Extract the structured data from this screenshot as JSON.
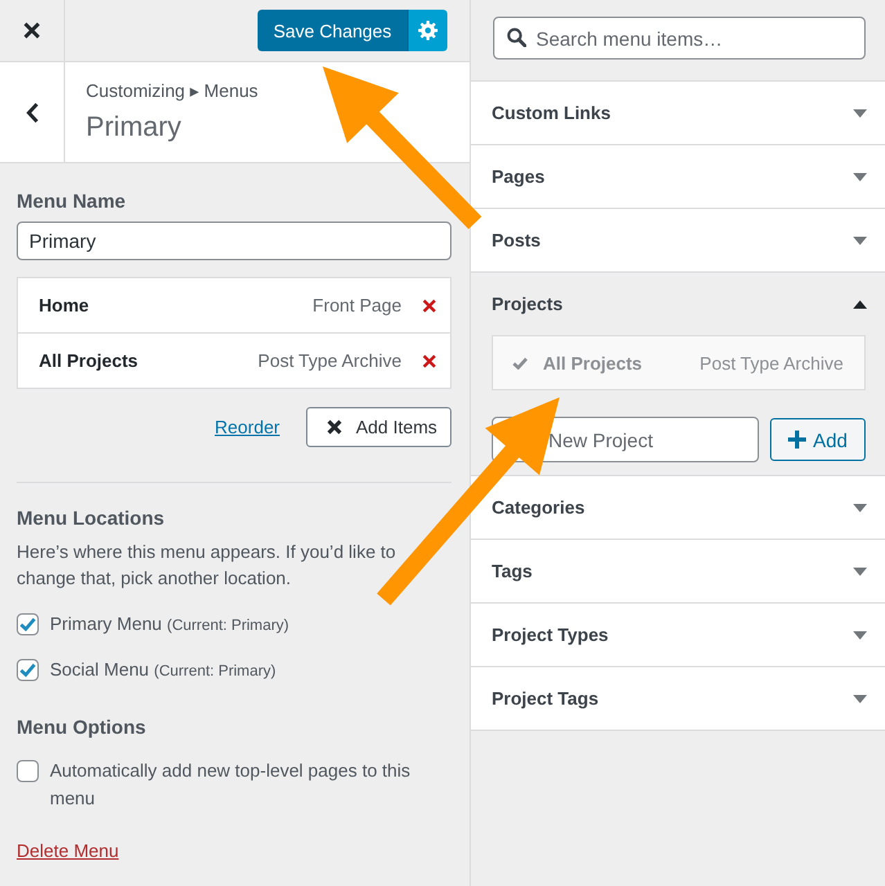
{
  "top_bar": {
    "save_button": "Save Changes"
  },
  "header": {
    "breadcrumb": "Customizing ▸ Menus",
    "title": "Primary"
  },
  "menu_name": {
    "label": "Menu Name",
    "value": "Primary"
  },
  "menu_items": [
    {
      "title": "Home",
      "type": "Front Page"
    },
    {
      "title": "All Projects",
      "type": "Post Type Archive"
    }
  ],
  "menu_actions": {
    "reorder_link": "Reorder",
    "add_items_button": "Add Items",
    "open": true
  },
  "menu_locations": {
    "heading": "Menu Locations",
    "description": "Here’s where this menu appears. If you’d like to change that, pick another location.",
    "locations": [
      {
        "label": "Primary Menu",
        "note": "(Current: Primary)",
        "checked": true
      },
      {
        "label": "Social Menu",
        "note": "(Current: Primary)",
        "checked": true
      }
    ]
  },
  "menu_options": {
    "heading": "Menu Options",
    "options": [
      {
        "label": "Automatically add new top-level pages to this menu",
        "checked": false
      }
    ]
  },
  "delete_link": "Delete Menu",
  "search": {
    "placeholder": "Search menu items…"
  },
  "sections": [
    {
      "title": "Custom Links",
      "expanded": false
    },
    {
      "title": "Pages",
      "expanded": false
    },
    {
      "title": "Posts",
      "expanded": false
    },
    {
      "title": "Projects",
      "expanded": true,
      "items": [
        {
          "title": "All Projects",
          "type": "Post Type Archive",
          "added": true
        }
      ],
      "new_item": {
        "placeholder": "New Project",
        "button": "Add"
      }
    },
    {
      "title": "Categories",
      "expanded": false
    },
    {
      "title": "Tags",
      "expanded": false
    },
    {
      "title": "Project Types",
      "expanded": false
    },
    {
      "title": "Project Tags",
      "expanded": false
    }
  ]
}
